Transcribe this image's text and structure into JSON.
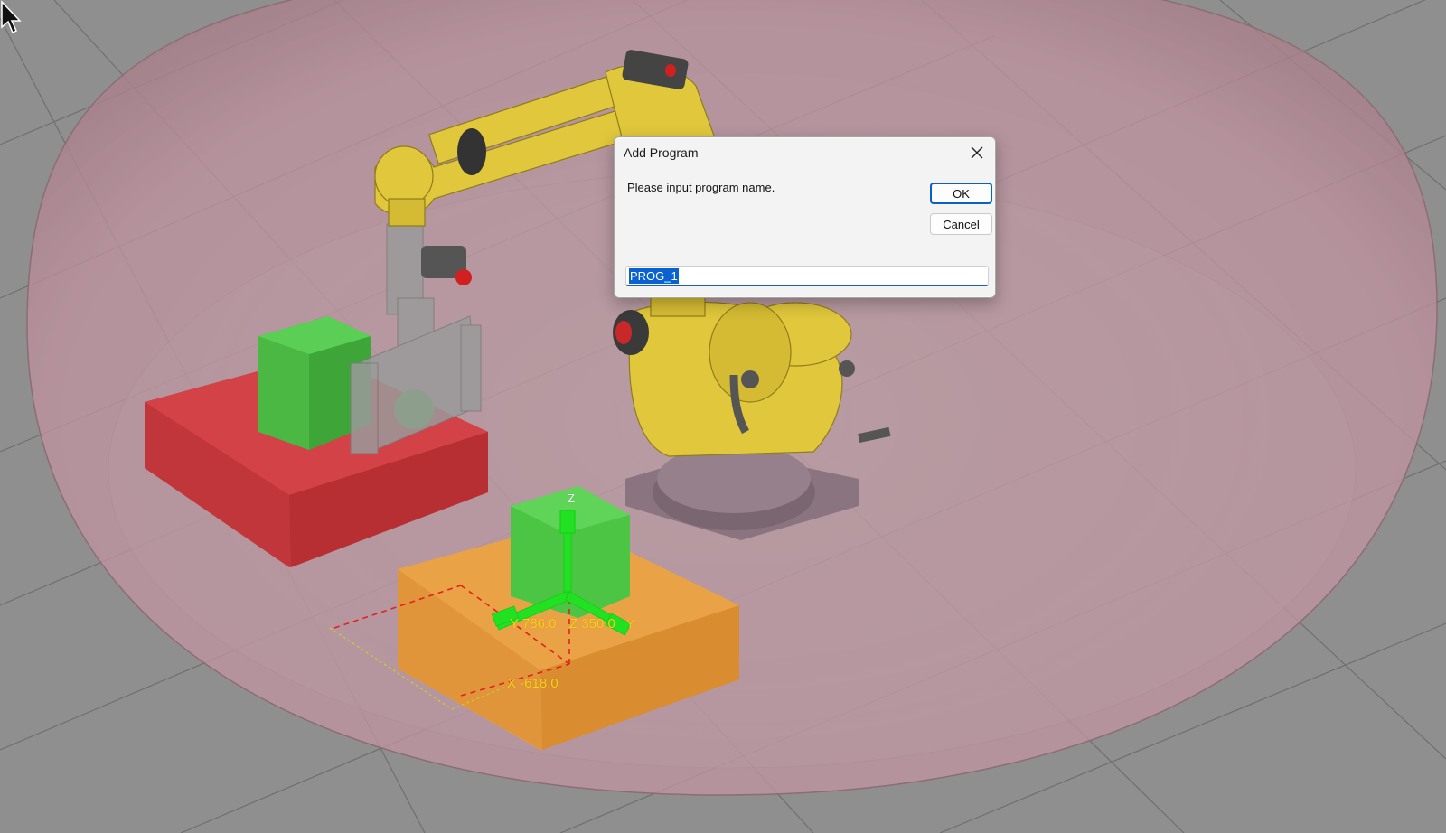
{
  "scene": {
    "coord_labels": {
      "y": "Y 786.0",
      "z": "Z 350.0",
      "x": "X -618.0",
      "axis_z": "Z",
      "axis_y": "Y"
    },
    "colors": {
      "background": "#8f8f8f",
      "envelope": "#d9a0b0",
      "robot": "#e0c83c",
      "red_table": "#c93a3a",
      "orange_table": "#e39a3e",
      "green_box": "#4fc64a",
      "triad": "#22e022",
      "label": "#ffd21a"
    }
  },
  "dialog": {
    "title": "Add Program",
    "prompt": "Please input program name.",
    "ok_label": "OK",
    "cancel_label": "Cancel",
    "input_value": "PROG_1",
    "close_icon": "close-icon"
  },
  "cursor": {
    "icon": "mouse-pointer-icon"
  }
}
